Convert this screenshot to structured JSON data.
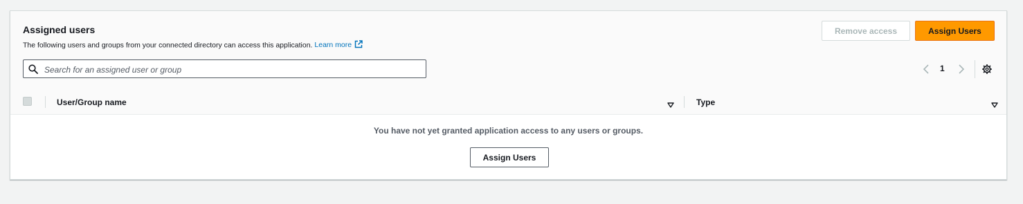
{
  "header": {
    "title": "Assigned users",
    "description": "The following users and groups from your connected directory can access this application.",
    "learn_more": "Learn more",
    "remove_access_label": "Remove access",
    "assign_users_label": "Assign Users"
  },
  "search": {
    "placeholder": "Search for an assigned user or group",
    "value": ""
  },
  "pagination": {
    "current_page": "1"
  },
  "table": {
    "columns": [
      "User/Group name",
      "Type"
    ],
    "rows": []
  },
  "empty_state": {
    "message": "You have not yet granted application access to any users or groups.",
    "button_label": "Assign Users"
  },
  "colors": {
    "accent": "#ff9900",
    "link": "#0073bb",
    "disabled_text": "#aab7b8",
    "background": "#f2f3f3"
  },
  "icons": [
    "external-link-icon",
    "search-icon",
    "chevron-left-icon",
    "chevron-right-icon",
    "settings-gear-icon",
    "sort-caret-icon"
  ]
}
